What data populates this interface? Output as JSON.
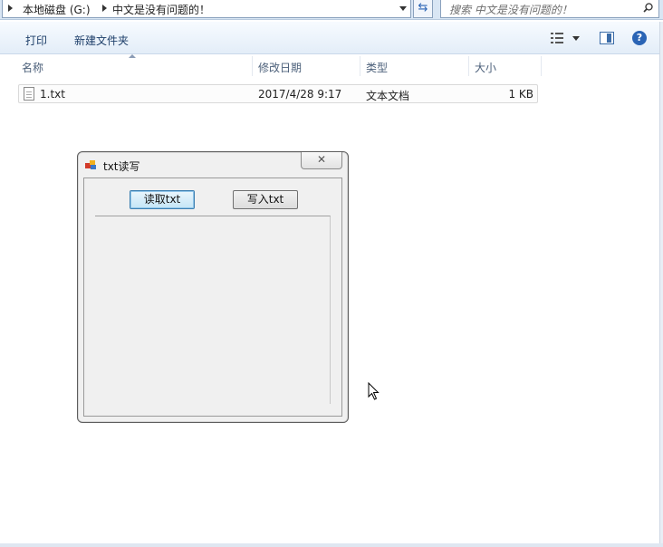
{
  "address_bar": {
    "crumbs": [
      "本地磁盘 (G:)",
      "中文是没有问题的！"
    ],
    "search_placeholder": "搜索 中文是没有问题的！"
  },
  "toolbar": {
    "print_label": "打印",
    "new_folder_label": "新建文件夹"
  },
  "columns": {
    "name": "名称",
    "modified": "修改日期",
    "type": "类型",
    "size": "大小"
  },
  "files": [
    {
      "name": "1.txt",
      "modified": "2017/4/28 9:17",
      "type": "文本文档",
      "size": "1 KB"
    }
  ],
  "dialog": {
    "title": "txt读写",
    "read_button": "读取txt",
    "write_button": "写入txt",
    "textbox_value": ""
  },
  "colors": {
    "accent": "#2a64b5",
    "focus_border": "#3c7fb1"
  }
}
